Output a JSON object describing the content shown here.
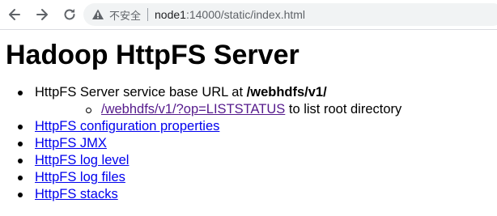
{
  "browser": {
    "security_label": "不安全",
    "url_host": "node1",
    "url_rest": ":14000/static/index.html"
  },
  "page": {
    "title": "Hadoop HttpFS Server",
    "base_url_text": "HttpFS Server service base URL at ",
    "base_url_path": "/webhdfs/v1/",
    "liststatus_link": "/webhdfs/v1/?op=LISTSTATUS",
    "liststatus_suffix": " to list root directory",
    "links": [
      "HttpFS configuration properties",
      "HttpFS JMX",
      "HttpFS log level",
      "HttpFS log files",
      "HttpFS stacks"
    ]
  },
  "colors": {
    "link": "#0000ee",
    "visited_link": "#551a8b"
  }
}
